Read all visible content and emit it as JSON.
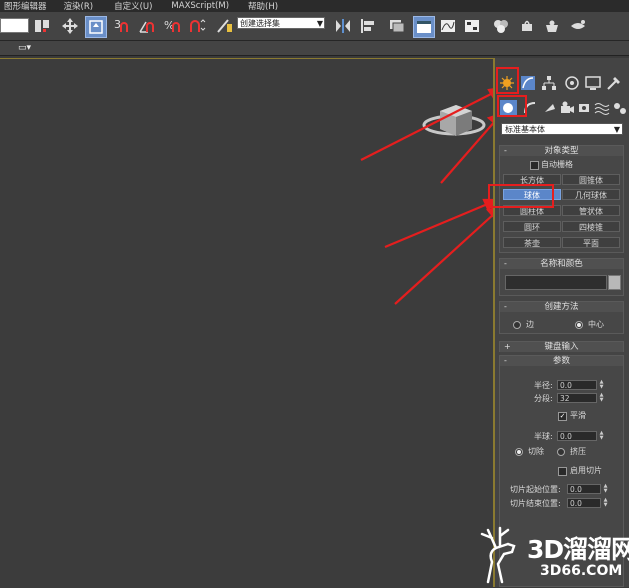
{
  "menu": [
    {
      "label": "图形编辑器"
    },
    {
      "label": "渲染(R)"
    },
    {
      "label": "自定义(U)"
    },
    {
      "label": "MAXScript(M)"
    },
    {
      "label": "帮助(H)"
    }
  ],
  "toolbar": {
    "selection_set_placeholder": "创建选择集"
  },
  "panel": {
    "dropdown_value": "标准基本体",
    "object_type": {
      "title": "对象类型",
      "autogrid_label": "自动栅格",
      "buttons": [
        "长方体",
        "圆锥体",
        "球体",
        "几何球体",
        "圆柱体",
        "管状体",
        "圆环",
        "四棱锥",
        "茶壶",
        "平面"
      ],
      "active": "球体"
    },
    "name_color": {
      "title": "名称和颜色"
    },
    "creation_method": {
      "title": "创建方法",
      "edge_label": "边",
      "center_label": "中心"
    },
    "keyboard_entry": {
      "title": "键盘输入"
    },
    "parameters": {
      "title": "参数",
      "radius_label": "半径:",
      "radius_value": "0.0",
      "segments_label": "分段:",
      "segments_value": "32",
      "smooth_label": "平滑",
      "hemisphere_label": "半球:",
      "hemisphere_value": "0.0",
      "chop_label": "切除",
      "squash_label": "挤压",
      "slice_on_label": "启用切片",
      "slice_from_label": "切片起始位置:",
      "slice_from_value": "0.0",
      "slice_to_label": "切片结束位置:",
      "slice_to_value": "0.0"
    }
  },
  "watermark": {
    "brand": "3D溜溜网",
    "url": "3D66.COM"
  },
  "colors": {
    "annotation": "#e51e1e",
    "active_button": "#5b86c9",
    "create_tab": "#f0a020"
  }
}
